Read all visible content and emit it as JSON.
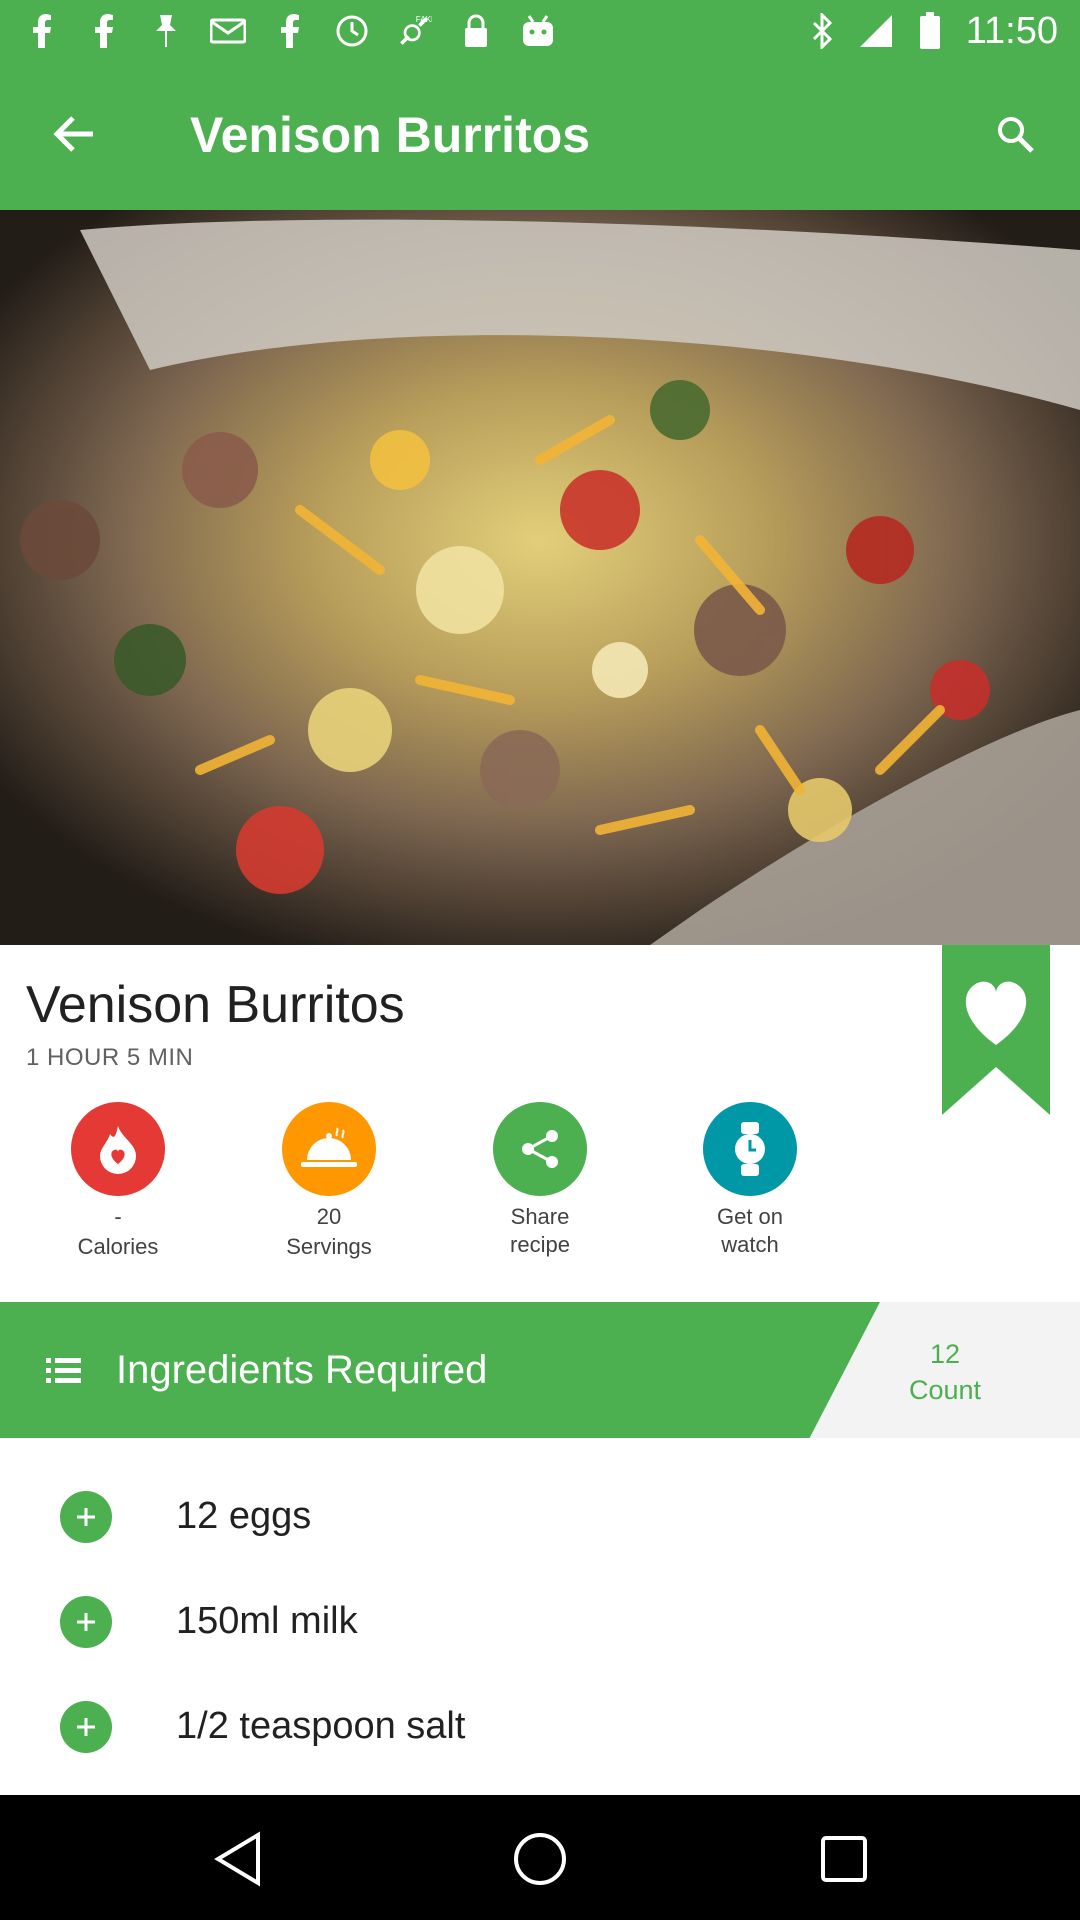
{
  "status_bar": {
    "time": "11:50",
    "icons": [
      "facebook-icon",
      "facebook-icon",
      "pin-icon",
      "gmail-icon",
      "facebook-icon",
      "sync-icon",
      "fake-gps-icon",
      "lock-icon",
      "android-icon",
      "bluetooth-icon",
      "signal-icon",
      "battery-icon"
    ]
  },
  "app_bar": {
    "title": "Venison Burritos",
    "back_icon": "arrow-back-icon",
    "search_icon": "search-icon"
  },
  "hero_image": {
    "subject": "venison burrito filling"
  },
  "recipe": {
    "title": "Venison Burritos",
    "time": "1 HOUR 5 MIN"
  },
  "actions": [
    {
      "value": "-",
      "label": "Calories",
      "icon": "flame-heart-icon",
      "color": "#e53935"
    },
    {
      "value": "20",
      "label": "Servings",
      "icon": "cloche-icon",
      "color": "#ff9800"
    },
    {
      "value": "Share",
      "label": "recipe",
      "icon": "share-icon",
      "color": "#4caf50"
    },
    {
      "value": "Get on",
      "label": "watch",
      "icon": "watch-icon",
      "color": "#0097a7"
    }
  ],
  "ingredients": {
    "header": "Ingredients Required",
    "count_value": "12",
    "count_label": "Count",
    "items": [
      "12 eggs",
      "150ml milk",
      "1/2 teaspoon salt"
    ]
  },
  "colors": {
    "primary": "#4caf50",
    "calories": "#e53935",
    "servings": "#ff9800",
    "watch": "#0097a7"
  }
}
